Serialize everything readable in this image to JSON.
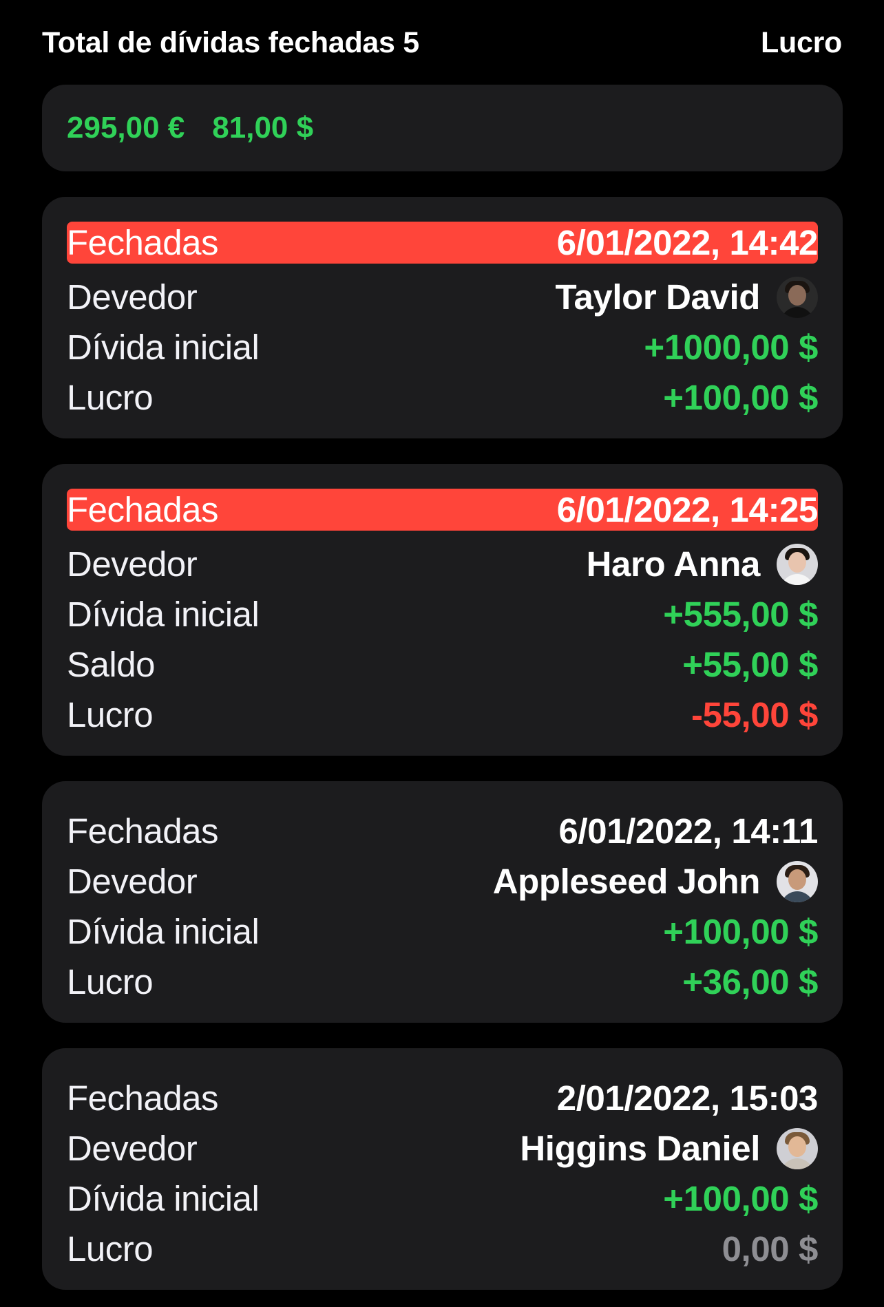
{
  "header": {
    "title": "Total de dívidas fechadas 5",
    "action": "Lucro"
  },
  "summary": {
    "amounts": [
      "295,00 €",
      "81,00 $"
    ],
    "color": "#30d158"
  },
  "cards": [
    {
      "status_label": "Fechadas",
      "date": "6/01/2022, 14:42",
      "highlighted": true,
      "debtor_label": "Devedor",
      "debtor_name": "Taylor David",
      "avatar": "avatar-taylor-david",
      "rows": [
        {
          "label": "Dívida inicial",
          "value": "+1000,00 $",
          "tone": "green"
        },
        {
          "label": "Lucro",
          "value": "+100,00 $",
          "tone": "green"
        }
      ]
    },
    {
      "status_label": "Fechadas",
      "date": "6/01/2022, 14:25",
      "highlighted": true,
      "debtor_label": "Devedor",
      "debtor_name": "Haro Anna",
      "avatar": "avatar-haro-anna",
      "rows": [
        {
          "label": "Dívida inicial",
          "value": "+555,00 $",
          "tone": "green"
        },
        {
          "label": "Saldo",
          "value": "+55,00 $",
          "tone": "green"
        },
        {
          "label": "Lucro",
          "value": "-55,00 $",
          "tone": "red"
        }
      ]
    },
    {
      "status_label": "Fechadas",
      "date": "6/01/2022, 14:11",
      "highlighted": false,
      "debtor_label": "Devedor",
      "debtor_name": "Appleseed John",
      "avatar": "avatar-appleseed-john",
      "rows": [
        {
          "label": "Dívida inicial",
          "value": "+100,00 $",
          "tone": "green"
        },
        {
          "label": "Lucro",
          "value": "+36,00 $",
          "tone": "green"
        }
      ]
    },
    {
      "status_label": "Fechadas",
      "date": "2/01/2022, 15:03",
      "highlighted": false,
      "debtor_label": "Devedor",
      "debtor_name": "Higgins Daniel",
      "avatar": "avatar-higgins-daniel",
      "rows": [
        {
          "label": "Dívida inicial",
          "value": "+100,00 $",
          "tone": "green"
        },
        {
          "label": "Lucro",
          "value": "0,00 $",
          "tone": "gray"
        }
      ]
    }
  ],
  "colors": {
    "background": "#000000",
    "card": "#1c1c1e",
    "positive": "#30d158",
    "negative": "#ff453a",
    "neutral": "#8e8e93",
    "highlight": "#ff453a"
  }
}
